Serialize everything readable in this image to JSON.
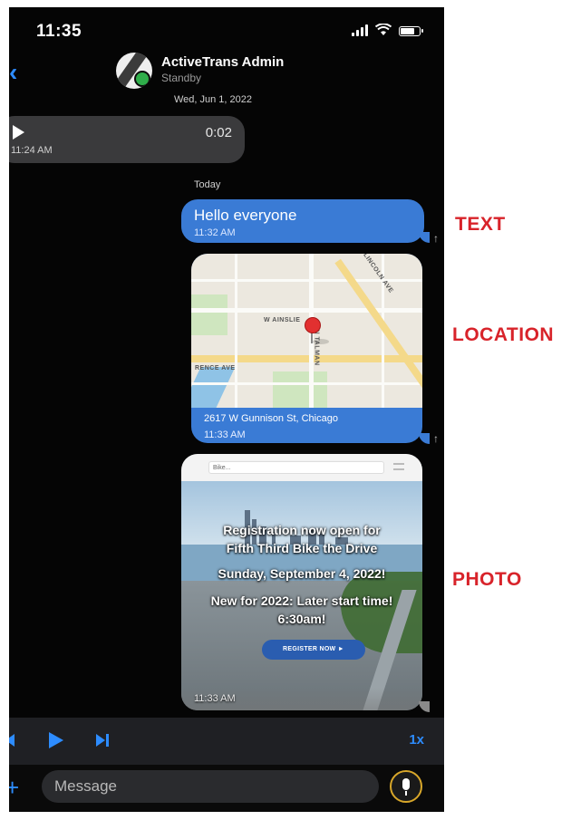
{
  "status_bar": {
    "time": "11:35"
  },
  "header": {
    "contact_name": "ActiveTrans Admin",
    "contact_status": "Standby"
  },
  "messages": {
    "date_separator": "Wed, Jun 1, 2022",
    "voice": {
      "duration": "0:02",
      "time": "11:24 AM"
    },
    "today_label": "Today",
    "text": {
      "body": "Hello everyone",
      "time": "11:32 AM"
    },
    "location": {
      "address": "2617 W Gunnison St, Chicago",
      "time": "11:33 AM",
      "map_labels": {
        "street_1": "LINCOLN AVE",
        "street_2": "W AINSLIE",
        "street_3": "RENCE AVE",
        "street_4": "N TALMAN"
      }
    },
    "photo": {
      "url_text": "Bike...",
      "line_1": "Registration now open for",
      "line_2": "Fifth Third Bike the Drive",
      "line_3": "Sunday, September 4, 2022!",
      "line_4": "New for 2022: Later start time!",
      "line_5": "6:30am!",
      "button": "REGISTER NOW",
      "time": "11:33 AM"
    }
  },
  "player": {
    "speed": "1x"
  },
  "composer": {
    "placeholder": "Message"
  },
  "annotations": {
    "text": "TEXT",
    "location": "LOCATION",
    "photo": "PHOTO"
  },
  "colors": {
    "bubble_blue": "#3a7bd5",
    "accent_blue": "#2d8cff",
    "annotation_red": "#d8232a",
    "mic_ring": "#d8a72a"
  }
}
